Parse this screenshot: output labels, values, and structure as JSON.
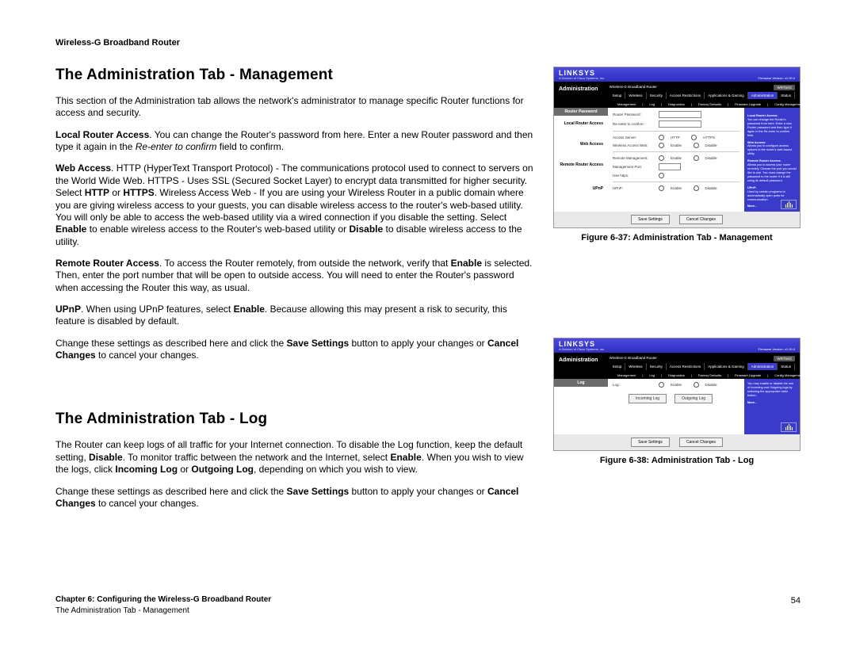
{
  "header": "Wireless-G Broadband Router",
  "section1_title": "The Administration Tab - Management",
  "section1_intro": "This section of the Administration tab allows the network's administrator to manage specific Router functions for access and security.",
  "local_access_label": "Local Router Access",
  "local_access_text1": ". You can change the Router's password from here. Enter a new Router password and then type it again in the ",
  "local_access_italic": "Re-enter to confirm",
  "local_access_text2": " field to confirm.",
  "web_access_label": "Web Access",
  "web_access_text1": ". HTTP (HyperText Transport Protocol) - The communications protocol used to connect to servers on the World Wide Web. HTTPS - Uses SSL (Secured Socket Layer) to encrypt data transmitted for higher security. Select ",
  "web_access_b1": "HTTP",
  "web_or": " or ",
  "web_access_b2": "HTTPS",
  "web_access_text2": ". Wireless Access Web - If you are using your Wireless Router in a public domain where you are giving wireless access to your guests, you can disable wireless access to the router's web-based utility. You will only be able to access the web-based utility via a wired connection if you disable the setting. Select ",
  "web_access_b3": "Enable",
  "web_access_text3": " to enable wireless access to the Router's web-based utility or ",
  "web_access_b4": "Disable",
  "web_access_text4": " to disable wireless access to the utility.",
  "remote_label": "Remote Router Access",
  "remote_text1": ". To access the Router remotely, from outside the network, verify that ",
  "remote_b1": "Enable",
  "remote_text2": " is selected. Then, enter the port number that will be open to outside access. You will need to enter the Router's password when accessing the Router this way, as usual.",
  "upnp_label": "UPnP",
  "upnp_text1": ". When using UPnP features, select ",
  "upnp_b1": "Enable",
  "upnp_text2": ". Because allowing this may present a risk to security, this feature is disabled by default.",
  "change_text1": "Change these settings as described here and click the ",
  "save_b": "Save Settings",
  "change_text2": " button to apply your changes or ",
  "cancel_b": "Cancel Changes",
  "change_text3": " to cancel your changes.",
  "section2_title": "The Administration Tab - Log",
  "log_p1a": "The Router can keep logs of all traffic for your Internet connection. To disable the Log function, keep the default setting, ",
  "log_b1": "Disable",
  "log_p1b": ". To monitor traffic between the network and the Internet, select ",
  "log_b2": "Enable",
  "log_p1c": ". When you wish to view the logs, click ",
  "log_b3": "Incoming Log",
  "log_p1d": " or ",
  "log_b4": "Outgoing Log",
  "log_p1e": ", depending on which you wish to view.",
  "fig1_caption": "Figure 6-37: Administration Tab - Management",
  "fig2_caption": "Figure 6-38: Administration Tab - Log",
  "footer_chapter": "Chapter 6: Configuring the Wireless-G Broadband Router",
  "footer_section": "The Administration Tab - Management",
  "page_number": "54",
  "ui": {
    "brand": "LINKSYS",
    "brand_sub": "A Division of Cisco Systems, Inc.",
    "product": "Wireless-G Broadband Router",
    "model": "WRT54G",
    "fw": "Firmware Version: v1.00.0",
    "section": "Administration",
    "tabs": [
      "Setup",
      "Wireless",
      "Security",
      "Access Restrictions",
      "Applications & Gaming",
      "Administration",
      "Status"
    ],
    "subtabs1": [
      "Management",
      "Log",
      "Diagnostics",
      "Factory Defaults",
      "Firmware Upgrade",
      "Config Management"
    ],
    "groups": {
      "pwd": "Router Password",
      "local": "Local Router Access",
      "web": "Web Access",
      "remote": "Remote Router Access",
      "upnp": "UPnP",
      "log": "Log"
    },
    "labels": {
      "router_pwd": "Router Password:",
      "reenter": "Re-enter to confirm:",
      "access_server": "Access Server:",
      "http": "HTTP",
      "https": "HTTPS",
      "wireless_web": "Wireless Access Web:",
      "enable": "Enable",
      "disable": "Disable",
      "remote_mgmt": "Remote Management:",
      "mgmt_port": "Management Port:",
      "use_https": "Use https:",
      "upnp": "UPnP:",
      "log": "Log:",
      "incoming": "Incoming Log",
      "outgoing": "Outgoing Log"
    },
    "help_mgmt": {
      "h1": "Local Router Access:",
      "t1": "You can change the Router's password from here. Enter a new Router password and then type it again in the Re-enter to confirm field.",
      "h2": "Web Access:",
      "t2": "Allows you to configure access options to the router's web-based utility.",
      "h3": "Remote Router Access:",
      "t3": "Allows you to access your router remotely. Choose the port you would like to use. You must change the password to the router if it is still using its default password.",
      "h4": "UPnP:",
      "t4": "Used by certain programs to automatically open ports for communication."
    },
    "help_log": {
      "t": "You may enable or disable the use of Incoming and Outgoing logs by selecting the appropriate radio button."
    },
    "more": "More...",
    "save": "Save Settings",
    "cancel": "Cancel Changes"
  }
}
